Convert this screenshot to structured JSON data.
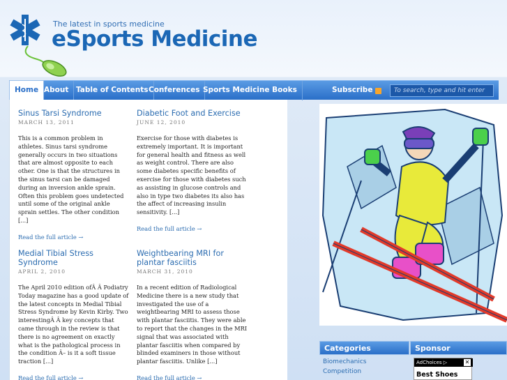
{
  "header": {
    "tagline": "The latest in sports medicine",
    "site_title": "eSports Medicine"
  },
  "nav": {
    "items": [
      {
        "label": "Home",
        "active": true
      },
      {
        "label": "About"
      },
      {
        "label": "Table of Contents"
      },
      {
        "label": "Conferences"
      },
      {
        "label": "Sports Medicine Books"
      }
    ],
    "subscribe": "Subscribe",
    "search_placeholder": "To search, type and hit enter"
  },
  "posts": [
    {
      "title": "Sinus Tarsi Syndrome",
      "date": "March 13, 2011",
      "excerpt": "This is a common problem in athletes. Sinus tarsi syndrome generally occurs in two situations that are almost opposite to each other. One is that the structures in the sinus tarsi can be damaged during an inversion ankle sprain. Often this problem goes undetected until some of the original ankle sprain settles. The other condition [...]",
      "read_more": "Read the full article →"
    },
    {
      "title": "Diabetic Foot and Exercise",
      "date": "June 12, 2010",
      "excerpt": "Exercise for those with diabetes is extremely important. It is important for general health and fitness as well as weight control. There are also some diabetes specific benefits of exercise for those with diabetes such as assisting in glucose controls and also in type two diabetes its also has the affect of increasing insulin sensitivity. [...]",
      "read_more": "Read the full article →"
    },
    {
      "title": "Medial Tibial Stress Syndrome",
      "date": "April 2, 2010",
      "excerpt": "The April 2010 edition ofÂ Â Podiatry Today magazine has a good update of the latest concepts in Medial Tibial Stress Syndrome by Kevin Kirby. Two interestingÂ Â key concepts that came through in the review is that there is no agreement on exactly what is the pathological process in the condition Â– is it a soft tissue traction [...]",
      "read_more": "Read the full article →"
    },
    {
      "title": "Weightbearing MRI for plantar fasciitis",
      "date": "March 31, 2010",
      "excerpt": "In a recent edition of Radiological Medicine there is a new study that investigated the use of a weightbearing MRI to assess those with plantar fasciitis. They were able to report that the changes in the MRI signal that was associated with plantar fasciitis when compared by blinded examiners in those without plantar fasciitis. Unlike [...]",
      "read_more": "Read the full article →"
    }
  ],
  "sidebar": {
    "categories_title": "Categories",
    "categories": [
      "Biomechanics",
      "Competition"
    ],
    "sponsor_title": "Sponsor",
    "ad_label": "AdChoices ▷",
    "ad_close": "✕",
    "ad_text": "Best Shoes"
  },
  "colors": {
    "brand_blue": "#1b67b5",
    "nav_blue": "#2a6fc8",
    "link_blue": "#2b6cb0"
  }
}
